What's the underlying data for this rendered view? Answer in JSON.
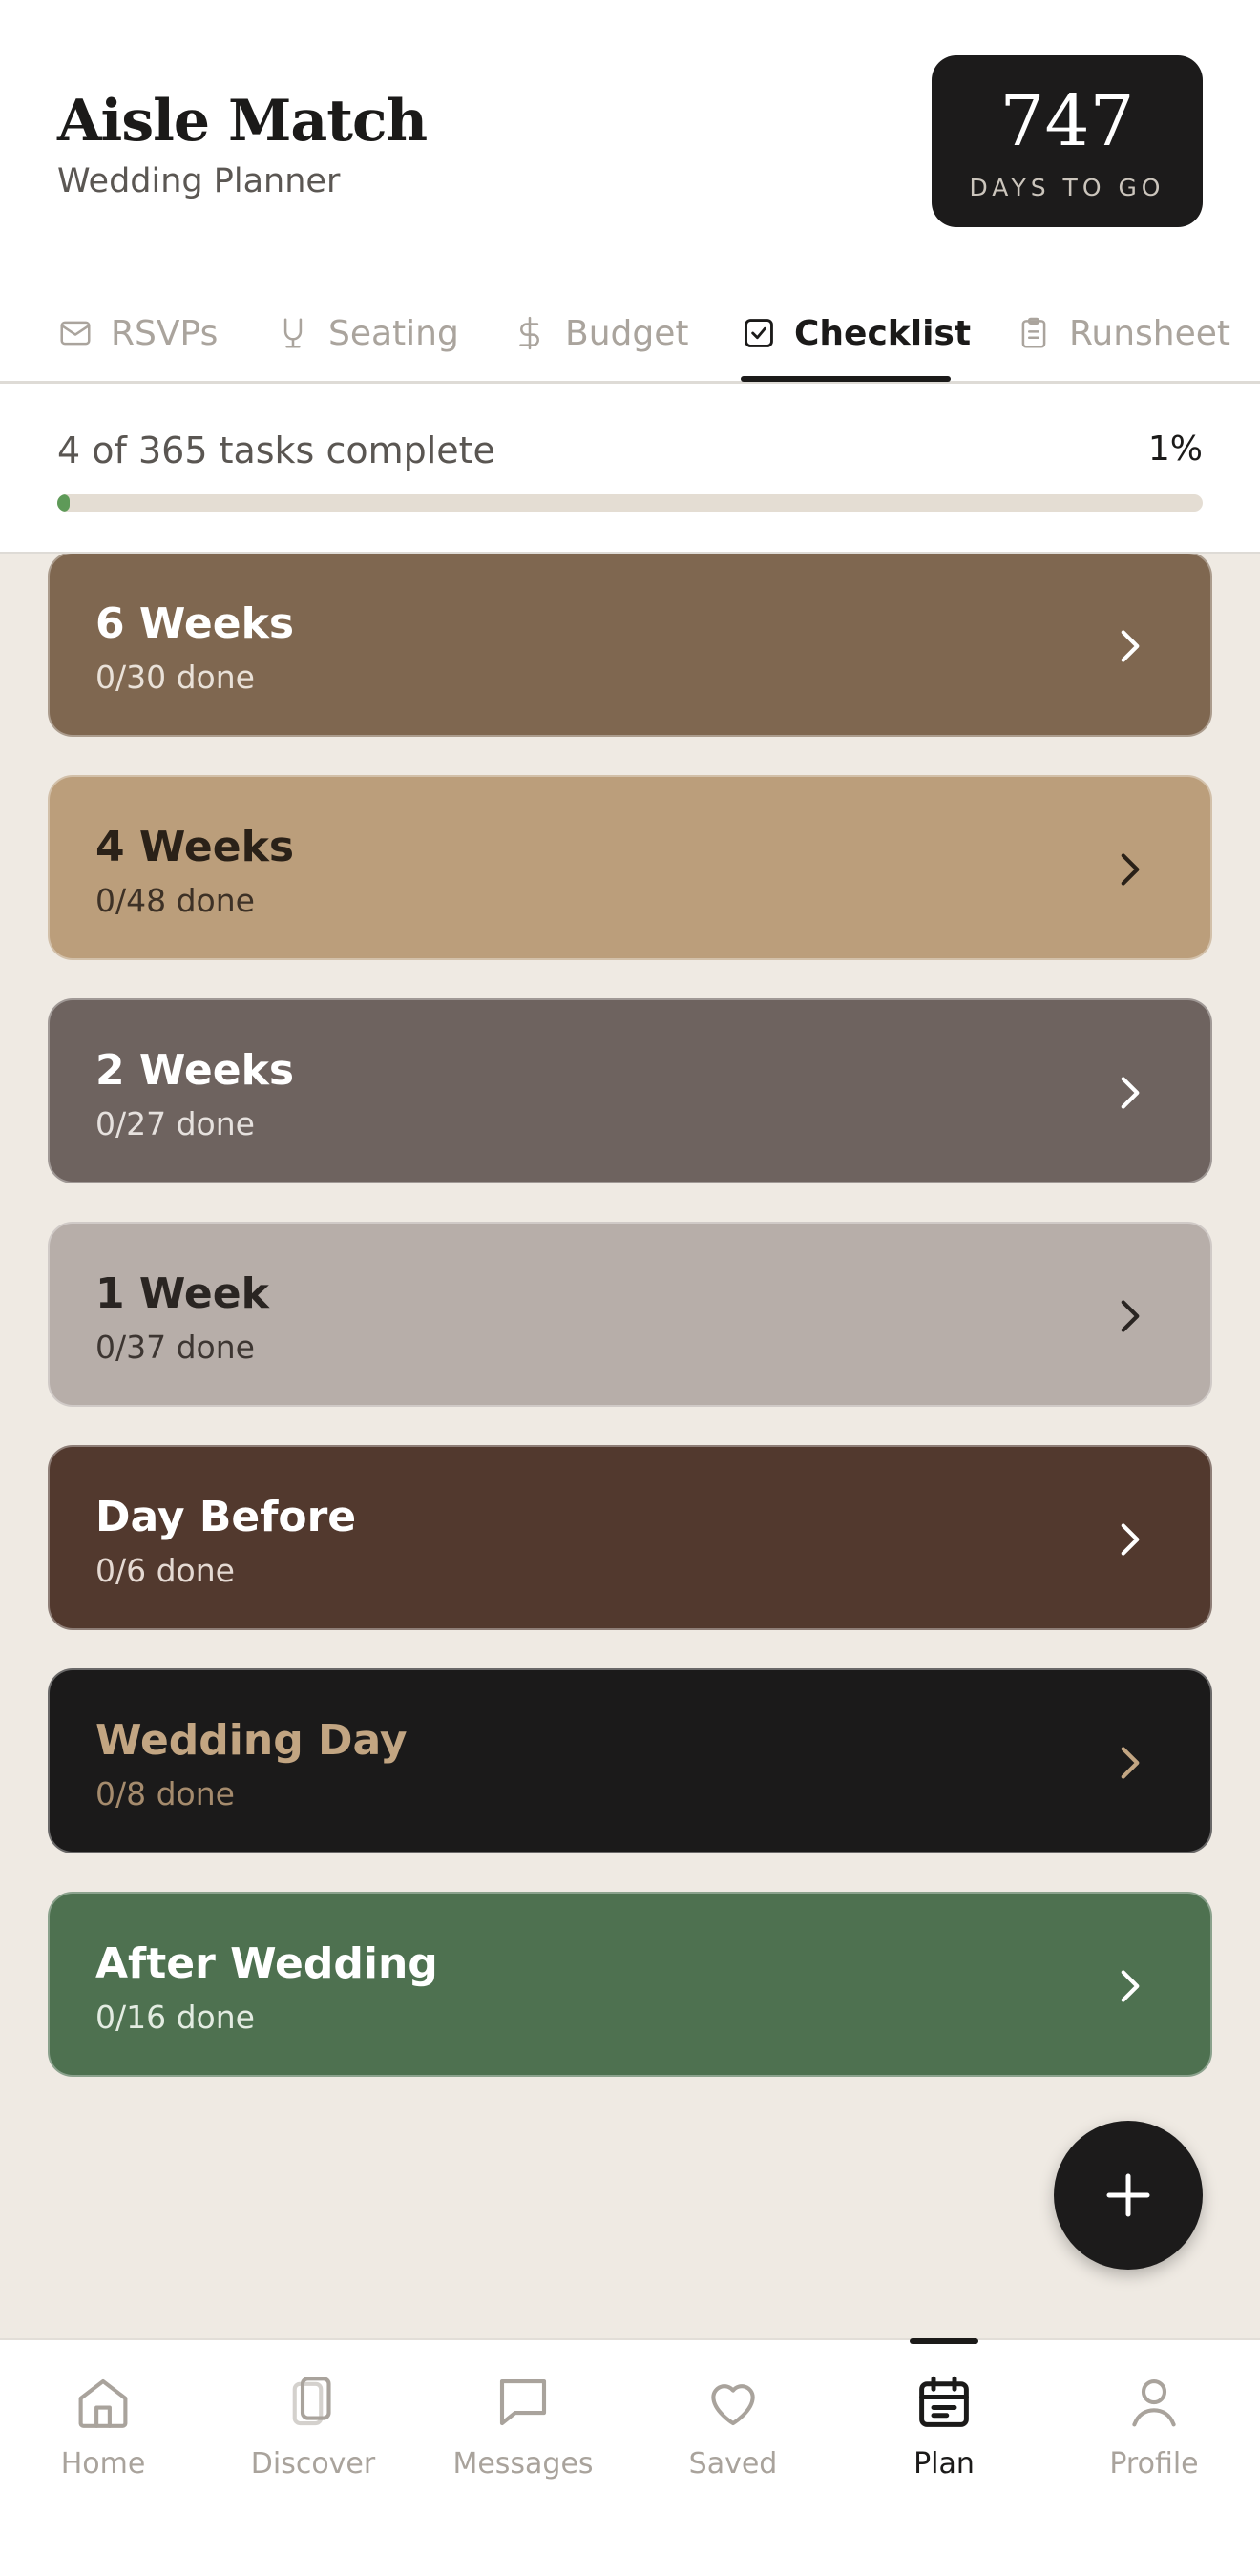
{
  "header": {
    "title": "Aisle Match",
    "subtitle": "Wedding Planner",
    "countdown_value": "747",
    "countdown_label": "DAYS TO GO"
  },
  "tabs": [
    {
      "label": "RSVPs",
      "icon": "mail-icon",
      "active": false
    },
    {
      "label": "Seating",
      "icon": "chair-icon",
      "active": false
    },
    {
      "label": "Budget",
      "icon": "dollar-icon",
      "active": false
    },
    {
      "label": "Checklist",
      "icon": "checkbox-icon",
      "active": true
    },
    {
      "label": "Runsheet",
      "icon": "clipboard-icon",
      "active": false
    }
  ],
  "progress": {
    "text": "4 of 365 tasks complete",
    "percent_label": "1%",
    "fraction": 0.011
  },
  "sections": [
    {
      "title": "6 Weeks",
      "subtitle": "0/30 done",
      "bg": "#7f6750",
      "title_color": "#ffffff",
      "sub_color": "#e9e1d8",
      "chevron_color": "#ffffff"
    },
    {
      "title": "4 Weeks",
      "subtitle": "0/48 done",
      "bg": "#bb9e7b",
      "title_color": "#2a2118",
      "sub_color": "#3d3126",
      "chevron_color": "#2a2118"
    },
    {
      "title": "2 Weeks",
      "subtitle": "0/27 done",
      "bg": "#6e635f",
      "title_color": "#ffffff",
      "sub_color": "#e6e1de",
      "chevron_color": "#ffffff"
    },
    {
      "title": "1 Week",
      "subtitle": "0/37 done",
      "bg": "#b7aea9",
      "title_color": "#2a2522",
      "sub_color": "#3d3632",
      "chevron_color": "#2a2522"
    },
    {
      "title": "Day Before",
      "subtitle": "0/6 done",
      "bg": "#52392e",
      "title_color": "#ffffff",
      "sub_color": "#e4d9d2",
      "chevron_color": "#ffffff"
    },
    {
      "title": "Wedding Day",
      "subtitle": "0/8 done",
      "bg": "#1b1a1a",
      "title_color": "#c2a582",
      "sub_color": "#a58b6d",
      "chevron_color": "#c2a582"
    },
    {
      "title": "After Wedding",
      "subtitle": "0/16 done",
      "bg": "#4e7150",
      "title_color": "#ffffff",
      "sub_color": "#e3ece2",
      "chevron_color": "#ffffff"
    }
  ],
  "fab": {
    "icon": "plus-icon"
  },
  "bottom_nav": [
    {
      "label": "Home",
      "icon": "home-icon",
      "active": false
    },
    {
      "label": "Discover",
      "icon": "cards-icon",
      "active": false
    },
    {
      "label": "Messages",
      "icon": "chat-icon",
      "active": false
    },
    {
      "label": "Saved",
      "icon": "heart-icon",
      "active": false
    },
    {
      "label": "Plan",
      "icon": "calendar-icon",
      "active": true
    },
    {
      "label": "Profile",
      "icon": "user-icon",
      "active": false
    }
  ]
}
